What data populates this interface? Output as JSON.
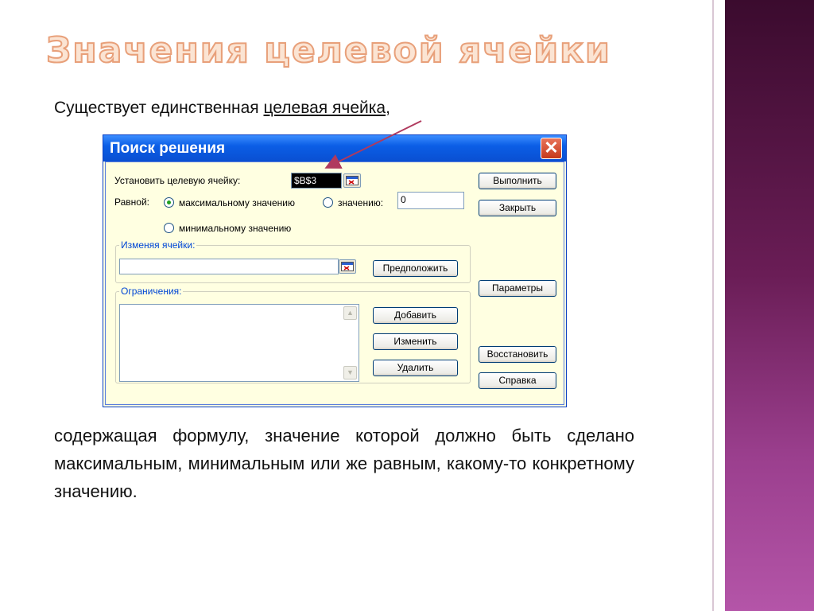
{
  "slide": {
    "title": "Значения целевой ячейки",
    "intro_prefix": "Существует единственная ",
    "intro_link": "целевая ячейка",
    "intro_suffix": ",",
    "body": "содержащая формулу, значение которой должно быть сделано максимальным, минимальным или же равным, какому-то конкретному значению."
  },
  "dialog": {
    "title": "Поиск решения",
    "close_label": "✕",
    "target_label": "Установить целевую ячейку:",
    "target_value": "$B$3",
    "equal_label": "Равной:",
    "radio_max": "максимальному значению",
    "radio_value": "значению:",
    "value_field": "0",
    "radio_min": "минимальному значению",
    "changing_group": "Изменяя ячейки:",
    "changing_value": "",
    "guess_button": "Предположить",
    "constraints_group": "Ограничения:",
    "add_button": "Добавить",
    "change_button": "Изменить",
    "delete_button": "Удалить",
    "solve_button": "Выполнить",
    "close_button": "Закрыть",
    "options_button": "Параметры",
    "reset_button": "Восстановить",
    "help_button": "Справка",
    "selected_radio": "max"
  },
  "colors": {
    "side_bar": "#6a1d56",
    "title_fill": "#fbe4d3",
    "title_outline": "#e8a07a",
    "dialog_bg": "#ffffe1",
    "titlebar": "#0a4fd1",
    "annotation_arrow": "#b03a5e"
  }
}
